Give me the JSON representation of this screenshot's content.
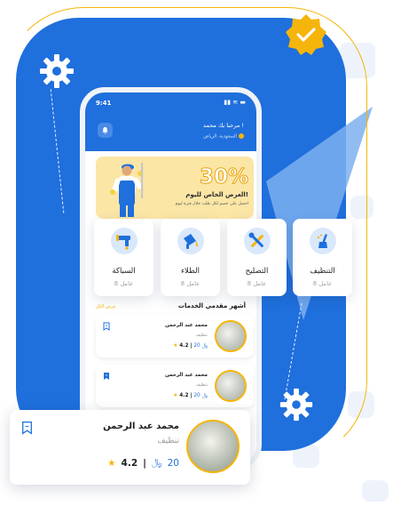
{
  "status": {
    "time": "9:41",
    "icons": "▮▮ ≋ ▬"
  },
  "header": {
    "greeting": "مرحبا بك محمد !",
    "location": "السعودية، الرياض"
  },
  "banner": {
    "discount": "30%",
    "title": "العرض الخاص لليوم!",
    "subtitle": "احصل على خصم لكل طلب خلال فترة ليوم"
  },
  "services": [
    {
      "label": "التنظيف",
      "count": "8 عامل",
      "icon": "cleaning-icon"
    },
    {
      "label": "التصليح",
      "count": "8 عامل",
      "icon": "tools-icon"
    },
    {
      "label": "الطلاء",
      "count": "8 عامل",
      "icon": "paint-icon"
    },
    {
      "label": "السباكة",
      "count": "8 عامل",
      "icon": "plumbing-icon"
    }
  ],
  "providers_section": {
    "title": "أشهر مقدمي الخدمات",
    "see_all": "عرض الكل"
  },
  "providers": [
    {
      "name": "محمد عبد الرحمن",
      "category": "تنظيف",
      "price": "20",
      "rating": "4.2",
      "saved": false
    },
    {
      "name": "محمد عبد الرحمن",
      "category": "تنظيف",
      "price": "20",
      "rating": "4.2",
      "saved": true
    }
  ],
  "featured_provider": {
    "name": "محمد عبد الرحمن",
    "category": "تنظيف",
    "price": "20",
    "rating": "4.2"
  },
  "colors": {
    "primary": "#1f6fdc",
    "accent": "#f5b50a"
  }
}
